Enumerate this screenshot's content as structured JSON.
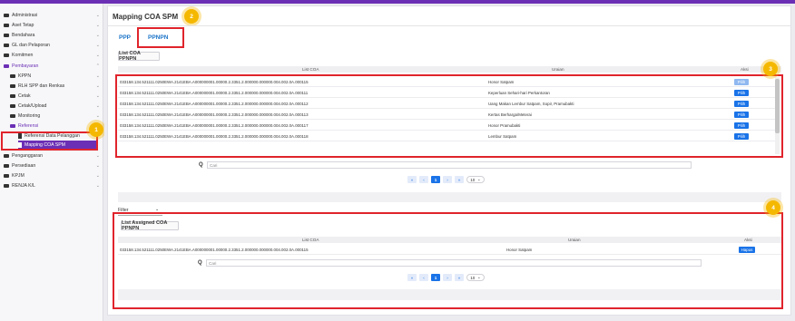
{
  "sidebar": {
    "items": [
      {
        "label": "Administrasi",
        "chevron": "⌄"
      },
      {
        "label": "Aset Tetap",
        "chevron": "⌄"
      },
      {
        "label": "Bendahara",
        "chevron": "⌄"
      },
      {
        "label": "GL dan Pelaporan",
        "chevron": "⌄"
      },
      {
        "label": "Komitmen",
        "chevron": "⌄"
      },
      {
        "label": "Pembayaran",
        "chevron": "⌃"
      },
      {
        "label": "KPPN",
        "chevron": "⌄"
      },
      {
        "label": "RLH SPP dan Renkas",
        "chevron": "⌄"
      },
      {
        "label": "Cetak",
        "chevron": "⌄"
      },
      {
        "label": "Cetak/Upload",
        "chevron": "⌄"
      },
      {
        "label": "Monitoring",
        "chevron": "⌄"
      },
      {
        "label": "Referensi",
        "chevron": "⌃"
      },
      {
        "label": "Referensi Data Pelanggan",
        "chevron": ""
      },
      {
        "label": "Mapping COA SPM",
        "chevron": ""
      },
      {
        "label": "Penganggaran",
        "chevron": "⌄"
      },
      {
        "label": "Persediaan",
        "chevron": "⌄"
      },
      {
        "label": "KPJM",
        "chevron": "⌄"
      },
      {
        "label": "RENJA K/L",
        "chevron": "⌄"
      }
    ]
  },
  "page": {
    "title": "Mapping COA SPM"
  },
  "tabs": {
    "ppp": "PPP",
    "ppnpn": "PPNPN"
  },
  "badges": {
    "b1": "1",
    "b2": "2",
    "b3": "3",
    "b4": "4"
  },
  "top_table": {
    "button": "List COA PPNPN",
    "headers": {
      "coa": "List COA",
      "uraian": "Uraian",
      "aksi": "Aksi"
    },
    "rows": [
      {
        "coa": "033158.134.521111.0250EWA.2141EBA.A000000001.00000.2.3351.2.000000.000000.004.002.0A.000115",
        "uraian": "Honor Satpam",
        "aksi": "Pilih"
      },
      {
        "coa": "033158.134.521111.0250EWA.2141EBA.A000000001.00000.2.3351.2.000000.000000.004.002.0A.000111",
        "uraian": "Keperluan Sehari-hari Perkantoran",
        "aksi": "Pilih"
      },
      {
        "coa": "033158.134.521111.0250EWA.2141EBA.A000000001.00000.2.3351.2.000000.000000.004.002.0A.000112",
        "uraian": "Uang Makan Lembur Satpam, Sopir, Pramubakti",
        "aksi": "Pilih"
      },
      {
        "coa": "033158.134.521111.0250EWA.2141EBA.A000000001.00000.2.3351.2.000000.000000.004.002.0A.000113",
        "uraian": "Kertas Berharga/Meterai",
        "aksi": "Pilih"
      },
      {
        "coa": "033158.134.521111.0250EWA.2141EBA.A000000001.00000.2.3351.2.000000.000000.004.002.0A.000117",
        "uraian": "Honor Pramubakti",
        "aksi": "Pilih"
      },
      {
        "coa": "033158.134.521111.0250EWA.2141EBA.A000000001.00000.2.3351.2.000000.000000.004.002.0A.000118",
        "uraian": "Lembur Satpam",
        "aksi": "Pilih"
      }
    ],
    "search_placeholder": "Cari",
    "pager": {
      "first": "«",
      "prev": "‹",
      "page": "1",
      "next": "›",
      "last": "»",
      "per_page": "10",
      "caret": "⌄"
    }
  },
  "filter": {
    "label": "Filter",
    "caret": "⌄"
  },
  "bottom_table": {
    "button": "List Assigned COA PPNPN",
    "headers": {
      "coa": "List COA",
      "uraian": "Uraian",
      "aksi": "Aksi"
    },
    "rows": [
      {
        "coa": "033158.134.521111.0250EWA.2141EBA.A000000001.00000.2.3351.2.000000.000000.004.002.0A.000115",
        "uraian": "Honor Satpam",
        "aksi": "Hapus"
      }
    ],
    "search_placeholder": "Cari",
    "pager": {
      "first": "«",
      "prev": "‹",
      "page": "1",
      "next": "›",
      "last": "»",
      "per_page": "10",
      "caret": "⌄"
    }
  },
  "icons": {
    "search": "search-icon",
    "folder": "folder-icon",
    "document": "document-icon"
  },
  "colors": {
    "accent": "#6b2fb5",
    "primary": "#1a73e8",
    "highlight": "#e0242c",
    "badge": "#f5b800"
  }
}
